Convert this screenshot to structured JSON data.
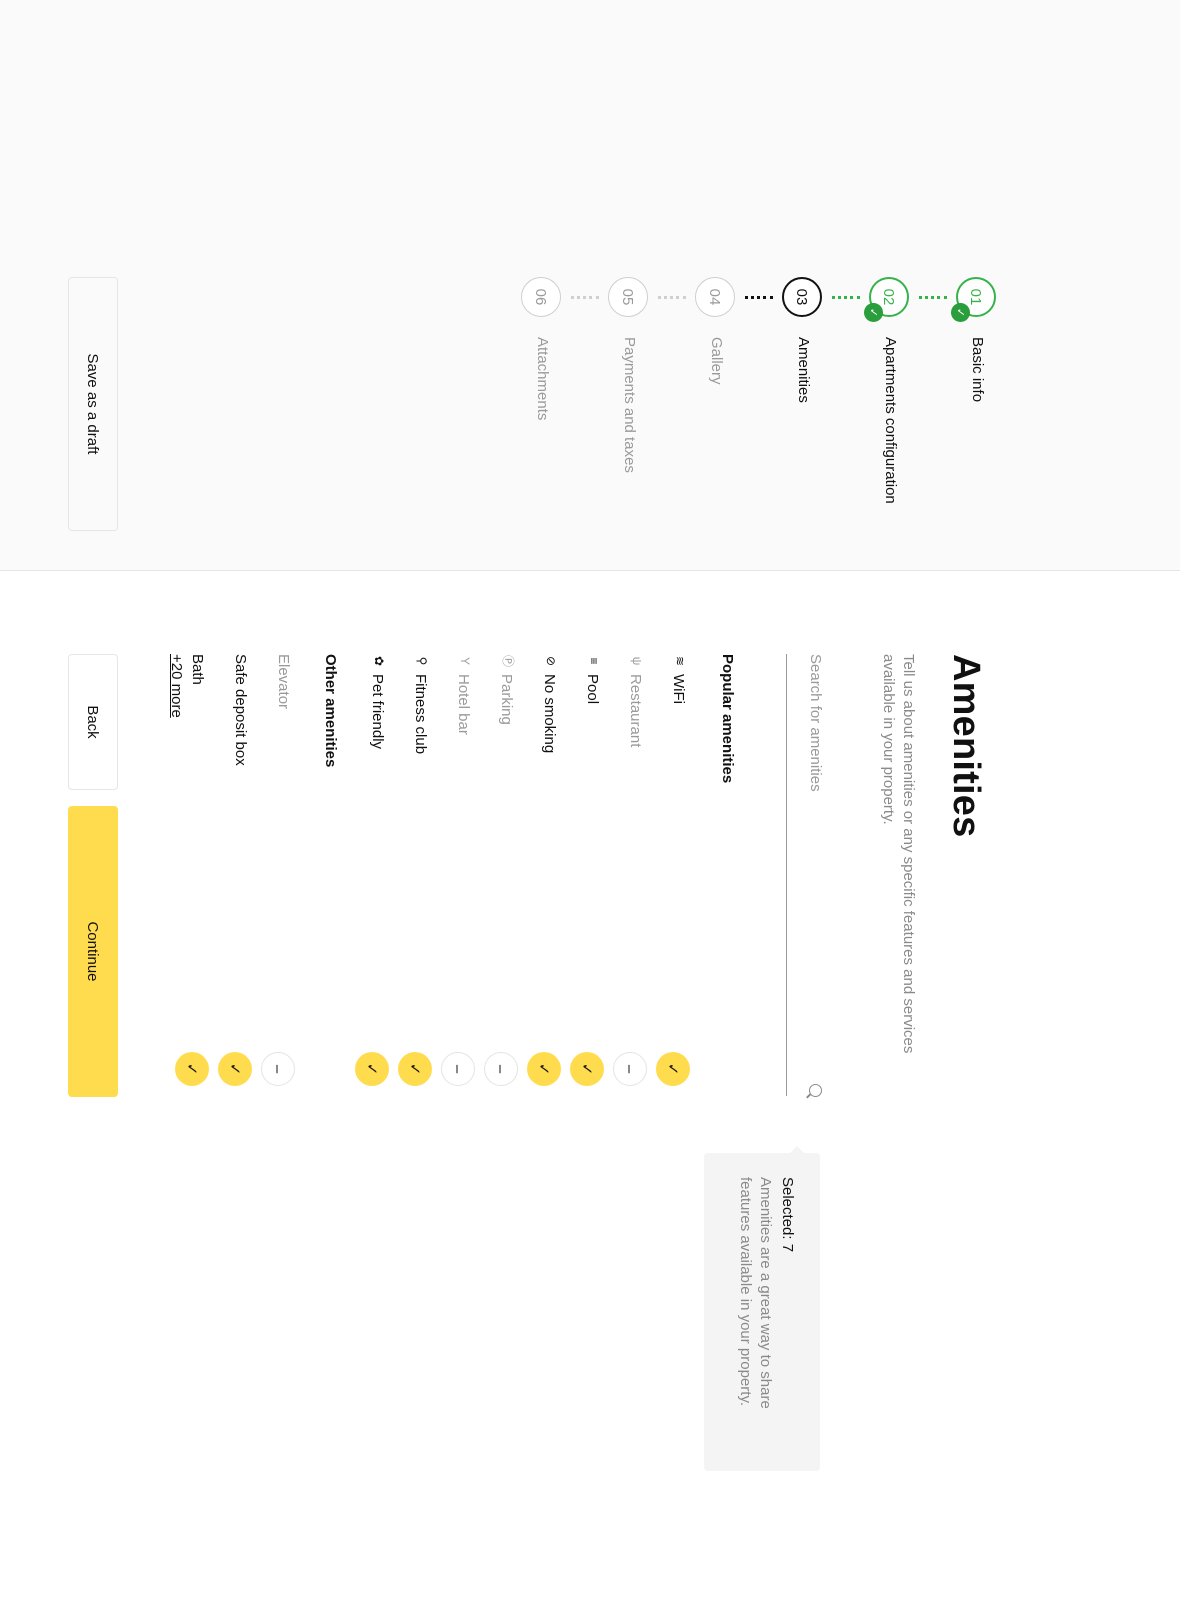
{
  "steps": [
    {
      "num": "01",
      "label": "Basic info",
      "state": "done"
    },
    {
      "num": "02",
      "label": "Apartments configuration",
      "state": "done"
    },
    {
      "num": "03",
      "label": "Amenities",
      "state": "current"
    },
    {
      "num": "04",
      "label": "Gallery",
      "state": "todo"
    },
    {
      "num": "05",
      "label": "Payments and taxes",
      "state": "todo"
    },
    {
      "num": "06",
      "label": "Attachments",
      "state": "todo"
    }
  ],
  "draft_label": "Save as a draft",
  "title": "Amenities",
  "subtitle": "Tell us about amenities or any specific features and services available in your property.",
  "search_placeholder": "Search for amenities",
  "popular_heading": "Popular amenities",
  "popular": [
    {
      "name": "WiFi",
      "icon": "wifi-icon",
      "glyph": "≋",
      "checked": true
    },
    {
      "name": "Restaurant",
      "icon": "restaurant-icon",
      "glyph": "ψ",
      "checked": false
    },
    {
      "name": "Pool",
      "icon": "pool-icon",
      "glyph": "≡",
      "checked": true
    },
    {
      "name": "No smoking",
      "icon": "no-smoking-icon",
      "glyph": "⊘",
      "checked": true
    },
    {
      "name": "Parking",
      "icon": "parking-icon",
      "glyph": "Ⓟ",
      "checked": false
    },
    {
      "name": "Hotel bar",
      "icon": "cocktail-icon",
      "glyph": "Y",
      "checked": false
    },
    {
      "name": "Fitness club",
      "icon": "dumbbell-icon",
      "glyph": "⚲",
      "checked": true
    },
    {
      "name": "Pet friendly",
      "icon": "paw-icon",
      "glyph": "✿",
      "checked": true
    }
  ],
  "other_heading": "Other amenities",
  "other": [
    {
      "name": "Elevator",
      "checked": false
    },
    {
      "name": "Safe deposit box",
      "checked": true
    },
    {
      "name": "Bath",
      "checked": true
    }
  ],
  "more_label": "+20 more",
  "back_label": "Back",
  "continue_label": "Continue",
  "tip_title": "Selected: 7",
  "tip_body": "Amenities are a great way to share features available in your property.",
  "colors": {
    "accent": "#ffdc4e",
    "done": "#36b24a",
    "check_badge": "#2a9d3c"
  }
}
